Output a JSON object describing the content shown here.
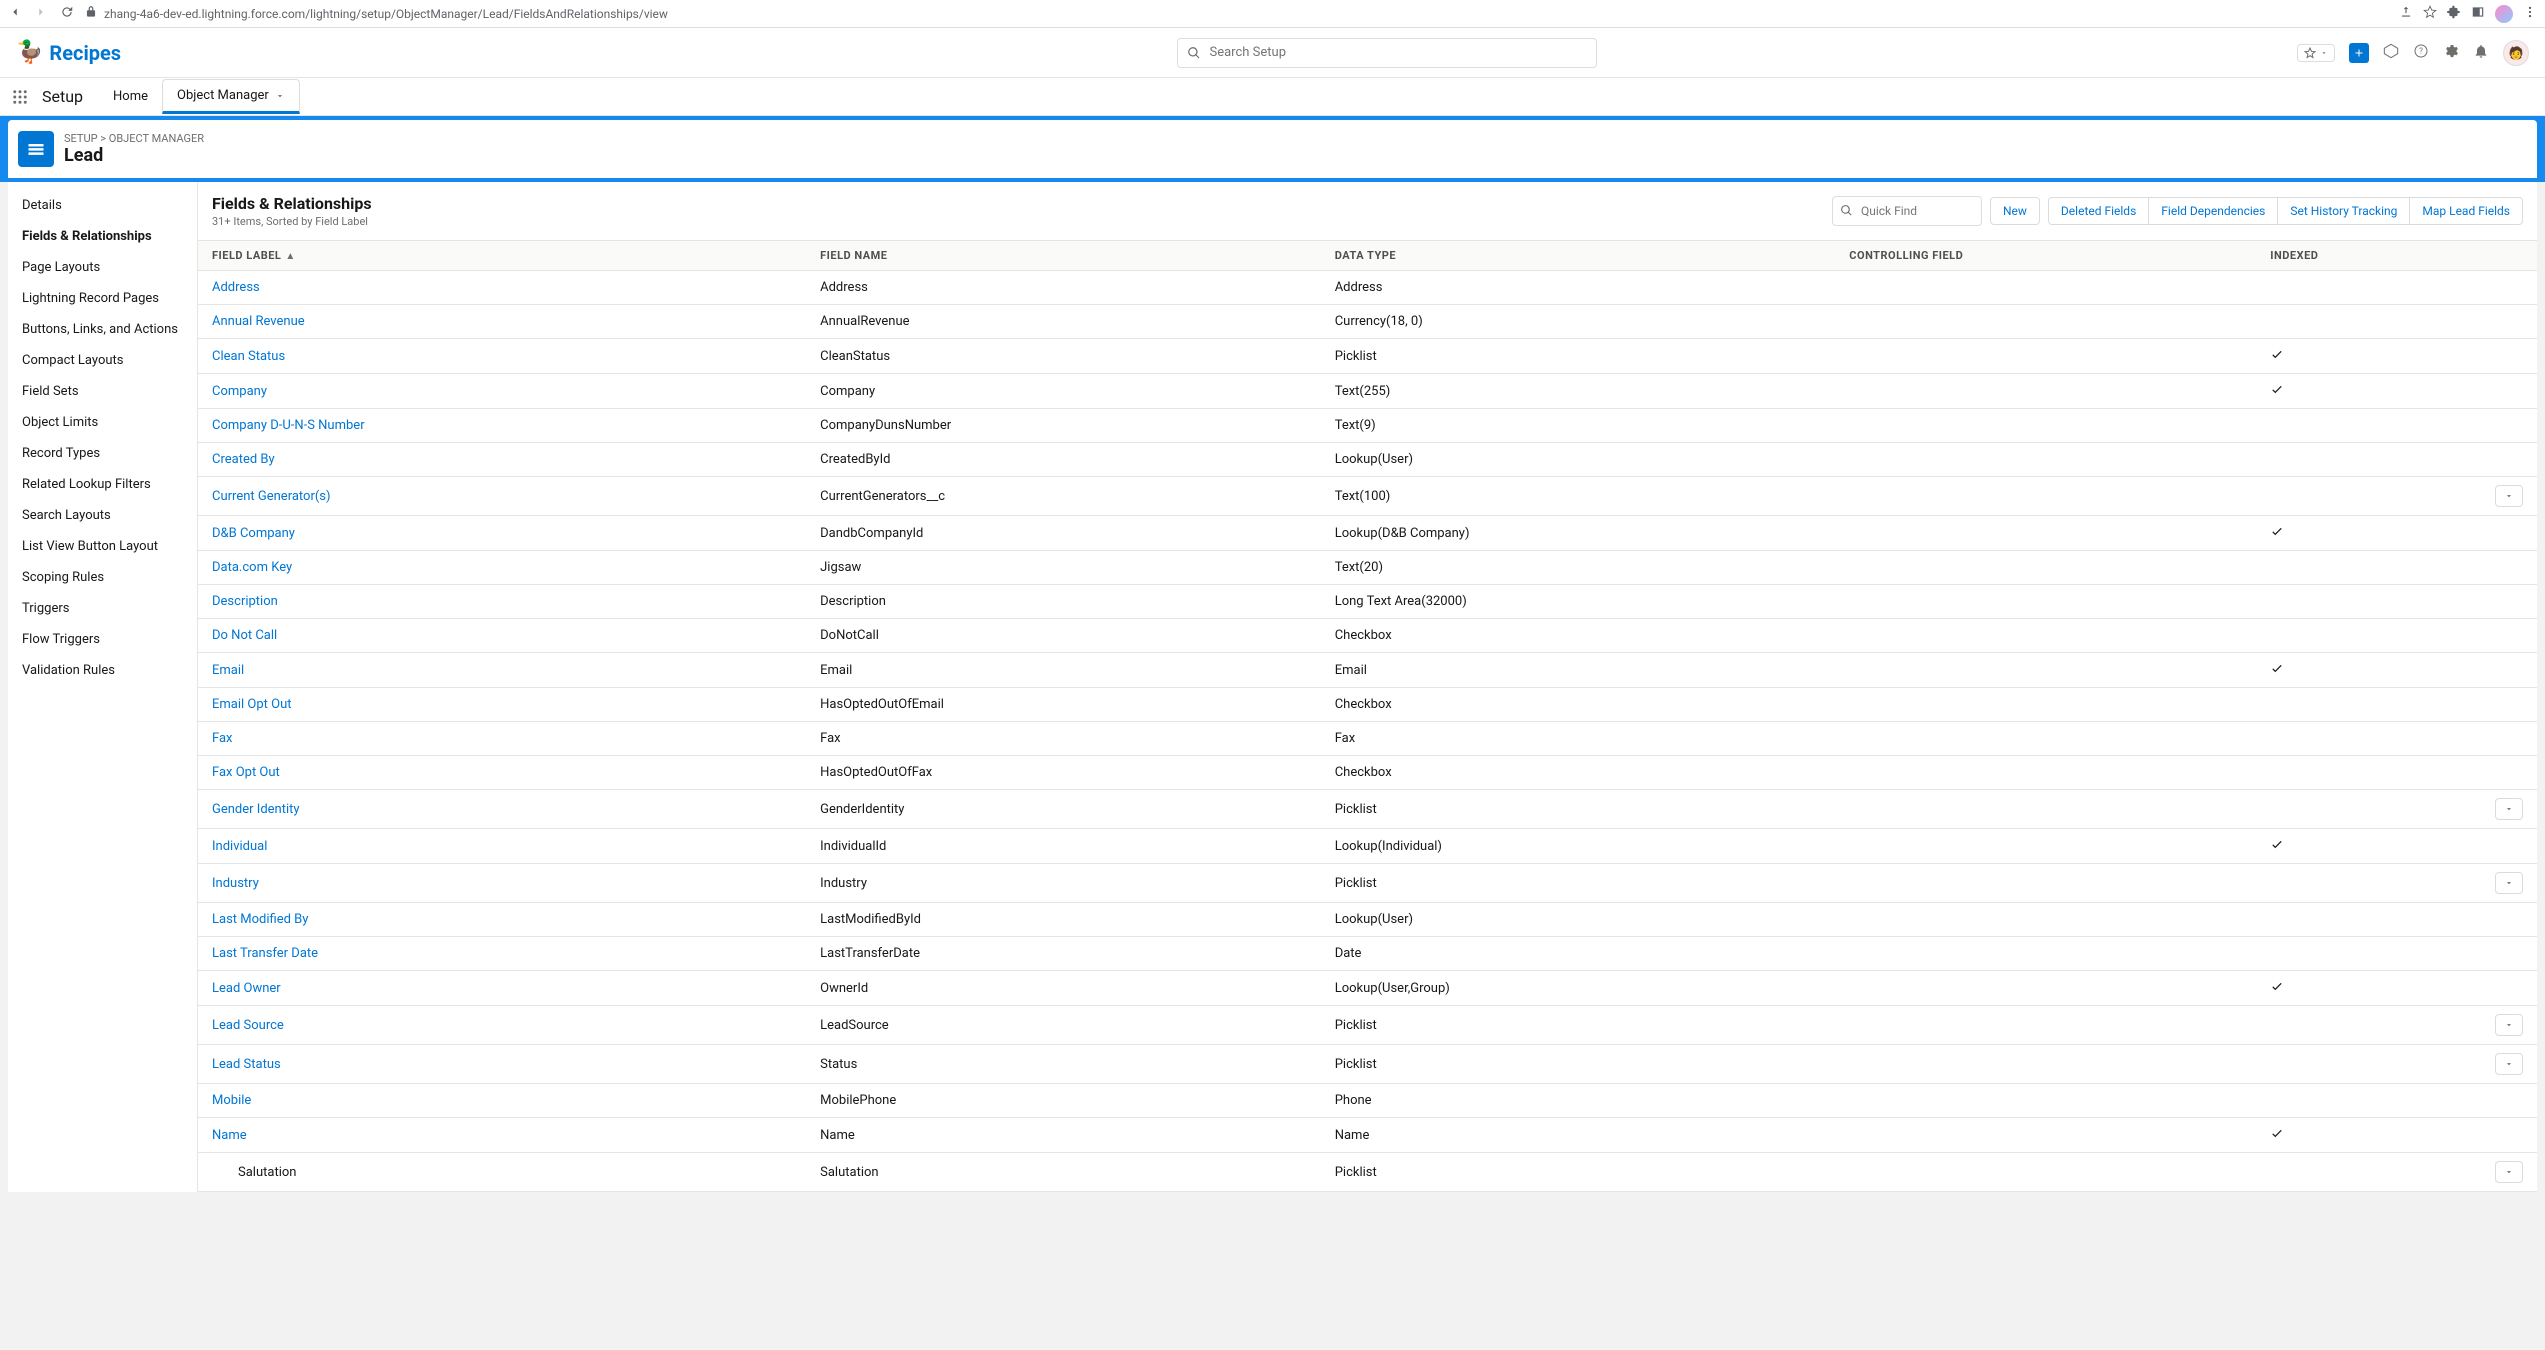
{
  "browser": {
    "url": "zhang-4a6-dev-ed.lightning.force.com/lightning/setup/ObjectManager/Lead/FieldsAndRelationships/view"
  },
  "header": {
    "app_name": "Recipes",
    "search_placeholder": "Search Setup"
  },
  "nav": {
    "setup_label": "Setup",
    "tabs": [
      {
        "label": "Home",
        "active": false
      },
      {
        "label": "Object Manager",
        "active": true
      }
    ]
  },
  "breadcrumb": {
    "setup": "SETUP",
    "object_manager": "OBJECT MANAGER",
    "title": "Lead"
  },
  "sidebar": {
    "items": [
      {
        "label": "Details"
      },
      {
        "label": "Fields & Relationships",
        "active": true
      },
      {
        "label": "Page Layouts"
      },
      {
        "label": "Lightning Record Pages"
      },
      {
        "label": "Buttons, Links, and Actions"
      },
      {
        "label": "Compact Layouts"
      },
      {
        "label": "Field Sets"
      },
      {
        "label": "Object Limits"
      },
      {
        "label": "Record Types"
      },
      {
        "label": "Related Lookup Filters"
      },
      {
        "label": "Search Layouts"
      },
      {
        "label": "List View Button Layout"
      },
      {
        "label": "Scoping Rules"
      },
      {
        "label": "Triggers"
      },
      {
        "label": "Flow Triggers"
      },
      {
        "label": "Validation Rules"
      }
    ]
  },
  "list": {
    "title": "Fields & Relationships",
    "subtitle": "31+ Items, Sorted by Field Label",
    "quick_find_placeholder": "Quick Find",
    "buttons": {
      "new": "New",
      "deleted": "Deleted Fields",
      "deps": "Field Dependencies",
      "history": "Set History Tracking",
      "map": "Map Lead Fields"
    },
    "columns": {
      "label": "FIELD LABEL",
      "name": "FIELD NAME",
      "type": "DATA TYPE",
      "controlling": "CONTROLLING FIELD",
      "indexed": "INDEXED"
    },
    "rows": [
      {
        "label": "Address",
        "name": "Address",
        "type": "Address",
        "indexed": false,
        "action": false,
        "indent": false
      },
      {
        "label": "Annual Revenue",
        "name": "AnnualRevenue",
        "type": "Currency(18, 0)",
        "indexed": false,
        "action": false,
        "indent": false
      },
      {
        "label": "Clean Status",
        "name": "CleanStatus",
        "type": "Picklist",
        "indexed": true,
        "action": false,
        "indent": false
      },
      {
        "label": "Company",
        "name": "Company",
        "type": "Text(255)",
        "indexed": true,
        "action": false,
        "indent": false
      },
      {
        "label": "Company D-U-N-S Number",
        "name": "CompanyDunsNumber",
        "type": "Text(9)",
        "indexed": false,
        "action": false,
        "indent": false
      },
      {
        "label": "Created By",
        "name": "CreatedById",
        "type": "Lookup(User)",
        "indexed": false,
        "action": false,
        "indent": false
      },
      {
        "label": "Current Generator(s)",
        "name": "CurrentGenerators__c",
        "type": "Text(100)",
        "indexed": false,
        "action": true,
        "indent": false
      },
      {
        "label": "D&B Company",
        "name": "DandbCompanyId",
        "type": "Lookup(D&B Company)",
        "indexed": true,
        "action": false,
        "indent": false
      },
      {
        "label": "Data.com Key",
        "name": "Jigsaw",
        "type": "Text(20)",
        "indexed": false,
        "action": false,
        "indent": false
      },
      {
        "label": "Description",
        "name": "Description",
        "type": "Long Text Area(32000)",
        "indexed": false,
        "action": false,
        "indent": false
      },
      {
        "label": "Do Not Call",
        "name": "DoNotCall",
        "type": "Checkbox",
        "indexed": false,
        "action": false,
        "indent": false
      },
      {
        "label": "Email",
        "name": "Email",
        "type": "Email",
        "indexed": true,
        "action": false,
        "indent": false
      },
      {
        "label": "Email Opt Out",
        "name": "HasOptedOutOfEmail",
        "type": "Checkbox",
        "indexed": false,
        "action": false,
        "indent": false
      },
      {
        "label": "Fax",
        "name": "Fax",
        "type": "Fax",
        "indexed": false,
        "action": false,
        "indent": false
      },
      {
        "label": "Fax Opt Out",
        "name": "HasOptedOutOfFax",
        "type": "Checkbox",
        "indexed": false,
        "action": false,
        "indent": false
      },
      {
        "label": "Gender Identity",
        "name": "GenderIdentity",
        "type": "Picklist",
        "indexed": false,
        "action": true,
        "indent": false
      },
      {
        "label": "Individual",
        "name": "IndividualId",
        "type": "Lookup(Individual)",
        "indexed": true,
        "action": false,
        "indent": false
      },
      {
        "label": "Industry",
        "name": "Industry",
        "type": "Picklist",
        "indexed": false,
        "action": true,
        "indent": false
      },
      {
        "label": "Last Modified By",
        "name": "LastModifiedById",
        "type": "Lookup(User)",
        "indexed": false,
        "action": false,
        "indent": false
      },
      {
        "label": "Last Transfer Date",
        "name": "LastTransferDate",
        "type": "Date",
        "indexed": false,
        "action": false,
        "indent": false
      },
      {
        "label": "Lead Owner",
        "name": "OwnerId",
        "type": "Lookup(User,Group)",
        "indexed": true,
        "action": false,
        "indent": false
      },
      {
        "label": "Lead Source",
        "name": "LeadSource",
        "type": "Picklist",
        "indexed": false,
        "action": true,
        "indent": false
      },
      {
        "label": "Lead Status",
        "name": "Status",
        "type": "Picklist",
        "indexed": false,
        "action": true,
        "indent": false
      },
      {
        "label": "Mobile",
        "name": "MobilePhone",
        "type": "Phone",
        "indexed": false,
        "action": false,
        "indent": false
      },
      {
        "label": "Name",
        "name": "Name",
        "type": "Name",
        "indexed": true,
        "action": false,
        "indent": false
      },
      {
        "label": "Salutation",
        "name": "Salutation",
        "type": "Picklist",
        "indexed": false,
        "action": true,
        "indent": true
      }
    ]
  }
}
